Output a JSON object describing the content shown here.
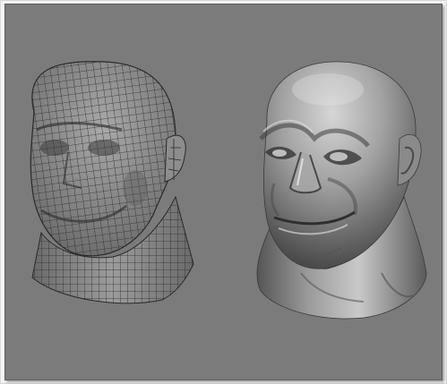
{
  "scene": {
    "background_color": "#7b7b7b",
    "wireframe_color": "#2a2a2a",
    "models": [
      {
        "kind": "head-mesh",
        "display": "wireframe-on-shaded"
      },
      {
        "kind": "head-mesh",
        "display": "smooth-shaded"
      }
    ]
  }
}
